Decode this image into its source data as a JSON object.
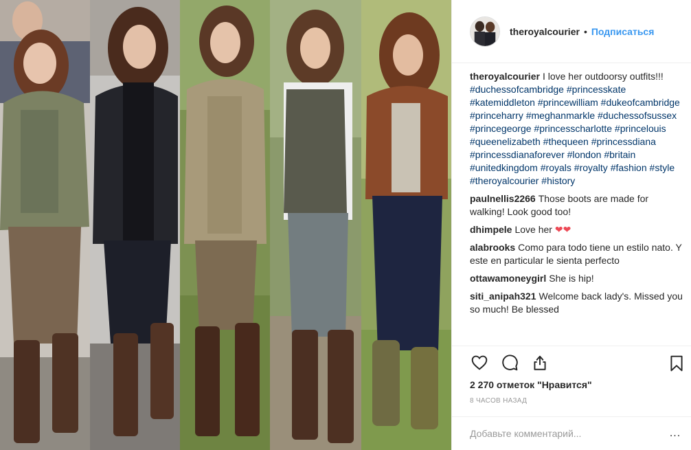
{
  "header": {
    "username": "theroyalcourier",
    "separator": "•",
    "follow_label": "Подписаться"
  },
  "caption": {
    "username": "theroyalcourier",
    "text": "I love her outdoorsy outfits!!!",
    "hashtags": [
      "#duchessofcambridge",
      "#princesskate",
      "#katemiddleton",
      "#princewilliam",
      "#dukeofcambridge",
      "#princeharry",
      "#meghanmarkle",
      "#duchessofsussex",
      "#princegeorge",
      "#princesscharlotte",
      "#princelouis",
      "#queenelizabeth",
      "#thequeen",
      "#princessdiana",
      "#princessdianaforever",
      "#london",
      "#britain",
      "#unitedkingdom",
      "#royals",
      "#royalty",
      "#fashion",
      "#style",
      "#theroyalcourier",
      "#history"
    ]
  },
  "comments": [
    {
      "username": "paulnellis2266",
      "text": "Those boots are made for walking! Look good too!"
    },
    {
      "username": "dhimpele",
      "text": "Love her ❤❤"
    },
    {
      "username": "alabrooks",
      "text": "Como para todo tiene un estilo nato. Y este en particular le sienta perfecto"
    },
    {
      "username": "ottawamoneygirl",
      "text": "She is hip!"
    },
    {
      "username": "siti_anipah321",
      "text": "Welcome back lady's. Missed you so much! Be blessed"
    }
  ],
  "actions": {
    "like_icon": "heart-icon",
    "comment_icon": "comment-icon",
    "share_icon": "share-icon",
    "save_icon": "bookmark-icon"
  },
  "likes": "2 270 отметок \"Нравится\"",
  "timestamp": "8 часов назад",
  "add_comment": {
    "placeholder": "Добавьте комментарий...",
    "more_label": "..."
  },
  "colors": {
    "link": "#3897f0",
    "hashtag": "#003569",
    "heart": "#ed4956",
    "muted": "#999999"
  }
}
